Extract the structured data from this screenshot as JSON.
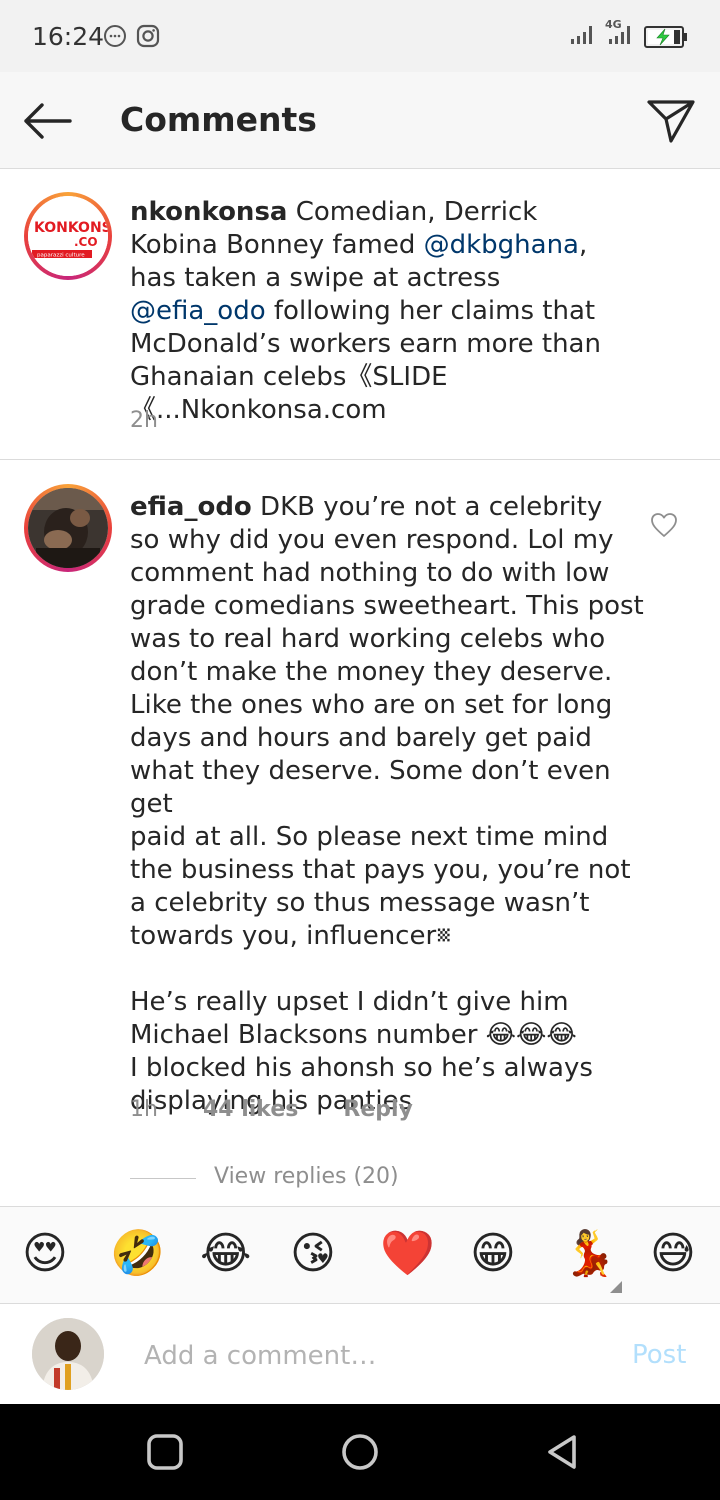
{
  "status_bar": {
    "time": "16:24",
    "network_label": "4G",
    "icons": [
      "chat-bubble-icon",
      "instagram-icon",
      "signal-icon",
      "signal-4g-icon",
      "battery-charging-icon"
    ]
  },
  "header": {
    "title": "Comments",
    "back_icon": "arrow-left-icon",
    "share_icon": "paper-plane-icon"
  },
  "caption": {
    "avatar_logo_text": "KONKONSA.CO",
    "avatar_tagline": "paparazzi culture",
    "username": "nkonkonsa",
    "segments": [
      " Comedian, Derrick Kobina Bonney famed ",
      "@dkbghana",
      ", has taken a swipe at actress ",
      "@efia_odo",
      " following her claims that McDonald’s workers earn more than Ghanaian celebs《SLIDE《...Nkonkonsa.com"
    ],
    "time": "2h"
  },
  "comment": {
    "username": "efia_odo",
    "lines": [
      " DKB you’re not a celebrity",
      "so why did you even respond. Lol my",
      "comment had nothing to do with low",
      "grade comedians sweetheart. This post",
      "was to real hard working celebs who",
      "don’t make the money they deserve.",
      "Like the ones who are on set for long",
      "days and hours and barely get paid",
      "what they deserve. Some don’t even get",
      "paid at all. So please next time mind",
      "the business that pays you, you’re not",
      "a celebrity so thus message wasn’t",
      "towards you, influencer␧",
      "",
      "He’s really upset I didn’t give him",
      "Michael Blacksons number 😂😂😂",
      "I blocked his ahonsh so he’s always",
      "displaying his panties"
    ],
    "time": "1h",
    "likes": "44 likes",
    "reply": "Reply",
    "view_replies": "View replies (20)"
  },
  "emoji_bar": [
    "😍",
    "🤣",
    "😂",
    "😘",
    "❤️",
    "😁",
    "💃",
    "😅"
  ],
  "compose": {
    "placeholder": "Add a comment…",
    "post_label": "Post"
  },
  "colors": {
    "mention": "#00376b",
    "meta_gray": "#8e8e8e",
    "post_disabled": "#b2dffc",
    "ring_orange": "#f9a339",
    "ring_pink": "#c8267a"
  }
}
